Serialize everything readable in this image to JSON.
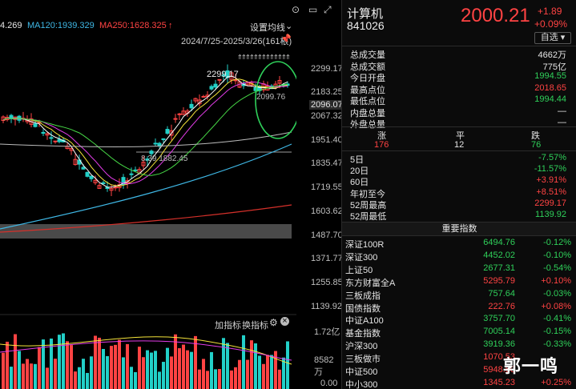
{
  "ma_legend": {
    "ma_prefix": "4.269",
    "ma120": "MA120:1939.329",
    "ma250": "MA250:1628.325",
    "ma250_arrow": "↑",
    "ma_settings": "设置均线",
    "ma_settings_caret": "⌄"
  },
  "date_range": "2024/7/25-2025/3/26(161根)",
  "annotations": {
    "peak": "2299.17",
    "low": "1882.45",
    "low_prefix": "8.39",
    "mid_label": "2099.76"
  },
  "price_axis": [
    "2299.17",
    "2183.25",
    "2096.07",
    "2067.32",
    "1951.40",
    "1835.47",
    "1719.55",
    "1603.62",
    "1487.70",
    "1371.77",
    "1255.85",
    "1139.92"
  ],
  "volume": {
    "toolbar_add": "加指标",
    "toolbar_switch": "换指标",
    "axis_top": "1.72亿",
    "axis_mid": "8582万",
    "axis_bottom": "0.00"
  },
  "stock": {
    "name": "计算机",
    "code": "841026",
    "price": "2000.21",
    "change": "+1.89",
    "change_pct": "+0.09%",
    "watchlist_btn": "自选",
    "watchlist_caret": "▾"
  },
  "stats": [
    {
      "label": "总成交量",
      "value": "4662万",
      "color": "white"
    },
    {
      "label": "总成交额",
      "value": "775亿",
      "color": "white"
    },
    {
      "label": "今日开盘",
      "value": "1994.55",
      "color": "green"
    },
    {
      "label": "最高点位",
      "value": "2018.65",
      "color": "red"
    },
    {
      "label": "最低点位",
      "value": "1994.44",
      "color": "green"
    },
    {
      "label": "内盘总量",
      "value": "—",
      "color": "white"
    },
    {
      "label": "外盘总量",
      "value": "—",
      "color": "white"
    }
  ],
  "breadth": {
    "up_label": "涨",
    "flat_label": "平",
    "down_label": "跌",
    "up": "176",
    "flat": "12",
    "down": "76"
  },
  "periods": [
    {
      "label": "5日",
      "value": "-7.57%",
      "color": "green"
    },
    {
      "label": "20日",
      "value": "-11.57%",
      "color": "green"
    },
    {
      "label": "60日",
      "value": "+3.91%",
      "color": "red"
    },
    {
      "label": "年初至今",
      "value": "+8.51%",
      "color": "red"
    },
    {
      "label": "52周最高",
      "value": "2299.17",
      "color": "red"
    },
    {
      "label": "52周最低",
      "value": "1139.92",
      "color": "green"
    }
  ],
  "indices_title": "重要指数",
  "indices": [
    {
      "name": "深证100R",
      "price": "6494.76",
      "change": "-0.12%",
      "color": "green"
    },
    {
      "name": "深证300",
      "price": "4452.02",
      "change": "-0.10%",
      "color": "green"
    },
    {
      "name": "上证50",
      "price": "2677.31",
      "change": "-0.54%",
      "color": "green"
    },
    {
      "name": "东方财富全A",
      "price": "5295.79",
      "change": "+0.10%",
      "color": "red"
    },
    {
      "name": "三板成指",
      "price": "757.64",
      "change": "-0.03%",
      "color": "green"
    },
    {
      "name": "国债指数",
      "price": "222.76",
      "change": "+0.08%",
      "color": "red"
    },
    {
      "name": "中证A100",
      "price": "3757.70",
      "change": "-0.41%",
      "color": "green"
    },
    {
      "name": "基金指数",
      "price": "7005.14",
      "change": "-0.15%",
      "color": "green"
    },
    {
      "name": "沪深300",
      "price": "3919.36",
      "change": "-0.33%",
      "color": "green"
    },
    {
      "name": "三板做市",
      "price": "1070.53",
      "change": "",
      "color": "red"
    },
    {
      "name": "中证500",
      "price": "5948.50",
      "change": "",
      "color": "red"
    },
    {
      "name": "中小300",
      "price": "1345.23",
      "change": "+0.25%",
      "color": "red"
    }
  ],
  "watermark": "郭一鸣",
  "colors": {
    "up": "#ff4343",
    "down": "#2fd05a",
    "ma_white": "#ffffff",
    "ma_yellow": "#f5e43a",
    "ma_magenta": "#e23ce8",
    "ma_green": "#46d846",
    "ma120": "#3fb8e6",
    "ma250": "#d4302a"
  }
}
